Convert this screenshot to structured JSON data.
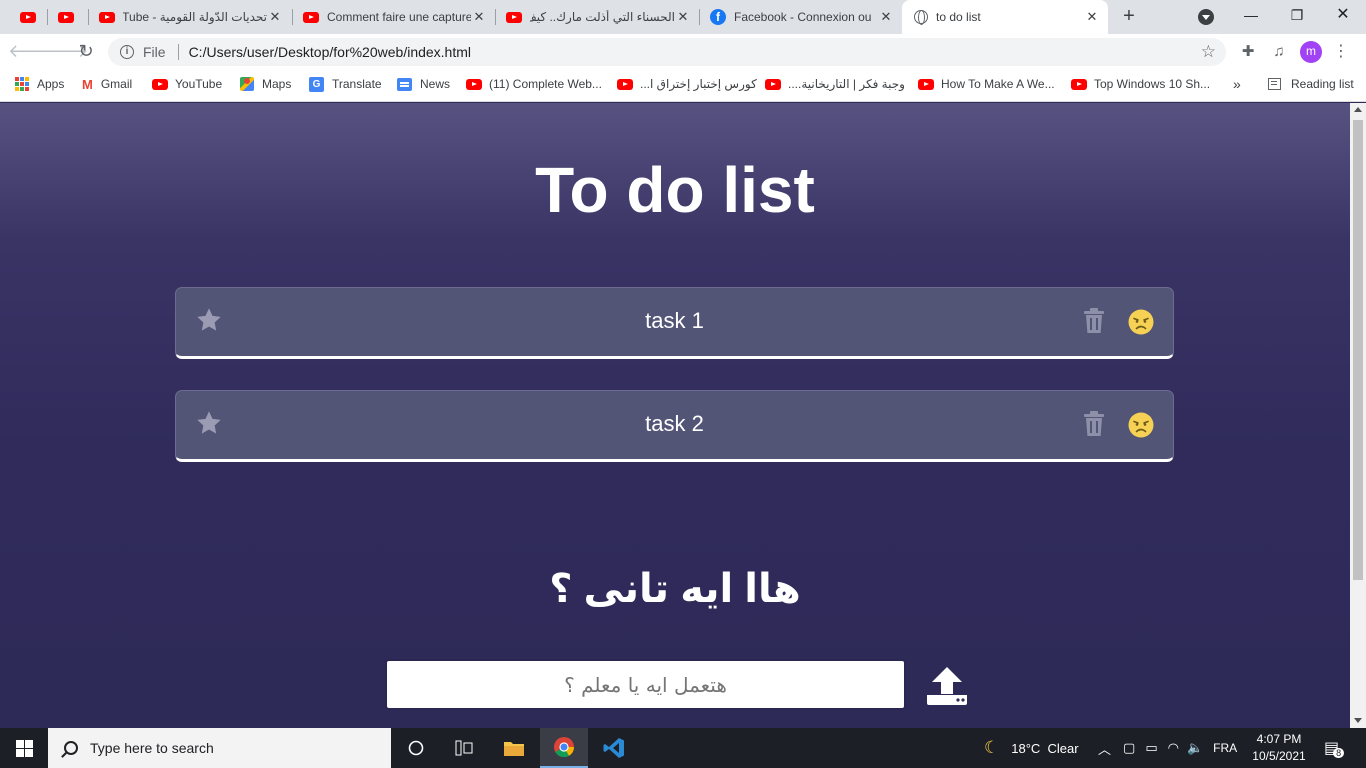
{
  "browser": {
    "tabs": [
      {
        "title": "",
        "icon": "youtube-icon"
      },
      {
        "title": "",
        "icon": "youtube-icon"
      },
      {
        "title": "تحديات الدّولة القومية - YouTube",
        "icon": "youtube-icon"
      },
      {
        "title": "Comment faire une capture",
        "icon": "youtube-icon"
      },
      {
        "title": "الحسناء التي أذلت مارك.. كيف",
        "icon": "youtube-icon"
      },
      {
        "title": "Facebook - Connexion ou",
        "icon": "facebook-icon"
      },
      {
        "title": "to do list",
        "icon": "globe-icon",
        "active": true
      }
    ],
    "omnibox": {
      "scheme_label": "File",
      "url": "C:/Users/user/Desktop/for%20web/index.html"
    },
    "profile_initial": "m",
    "bookmarks": [
      {
        "label": "Apps",
        "icon": "apps-icon"
      },
      {
        "label": "Gmail",
        "icon": "gmail-icon"
      },
      {
        "label": "YouTube",
        "icon": "youtube-icon"
      },
      {
        "label": "Maps",
        "icon": "maps-icon"
      },
      {
        "label": "Translate",
        "icon": "translate-icon"
      },
      {
        "label": "News",
        "icon": "news-icon"
      },
      {
        "label": "(11) Complete Web...",
        "icon": "youtube-icon"
      },
      {
        "label": "كورس إختبار إختراق ا...",
        "icon": "youtube-icon"
      },
      {
        "label": "وجبة فكر | التاريخانية....",
        "icon": "youtube-icon"
      },
      {
        "label": "How To Make A We...",
        "icon": "youtube-icon"
      },
      {
        "label": "Top Windows 10 Sh...",
        "icon": "youtube-icon"
      }
    ],
    "more_bookmarks": "»",
    "reading_list": "Reading list"
  },
  "page": {
    "title": "To do list",
    "tasks": [
      {
        "text": "task 1"
      },
      {
        "text": "task 2"
      }
    ],
    "subtitle": "هاا ايه تانى ؟",
    "input": {
      "placeholder": "هتعمل ايه يا معلم ؟",
      "value": ""
    }
  },
  "taskbar": {
    "search_placeholder": "Type here to search",
    "weather": "18°C  Clear",
    "language": "FRA",
    "time": "4:07 PM",
    "date": "10/5/2021",
    "notification_count": "8"
  },
  "colors": {
    "page_bg": "#2f2a55",
    "task_bg": "#535577",
    "emoji": "#f7d154"
  }
}
